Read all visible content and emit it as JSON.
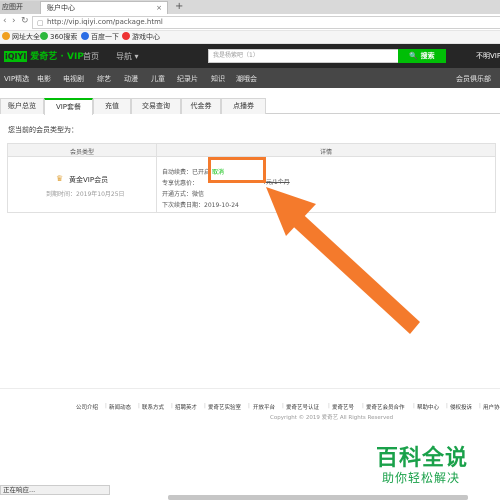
{
  "browser": {
    "tabs": [
      "应图开",
      "账户中心"
    ],
    "new_tab_symbol": "+",
    "close_symbol": "×",
    "url": "http://vip.iqiyi.com/package.html",
    "bookmarks": [
      "网址大全",
      "360搜索",
      "百度一下",
      "游戏中心"
    ]
  },
  "header": {
    "logo_box": "iQIYI",
    "logo_text": "爱奇艺 · VIP",
    "nav": [
      "首页",
      "导航 ▾"
    ],
    "search_placeholder": "我是杨紫吧（1）",
    "search_button": "🔍 搜索",
    "login": "不明VIP"
  },
  "categories": [
    "VIP精选",
    "电影",
    "电视剧",
    "综艺",
    "动漫",
    "儿童",
    "纪录片",
    "知识",
    "潮哦会",
    "会员俱乐部"
  ],
  "page_tabs": [
    "账户总览",
    "VIP套餐",
    "充值",
    "交易查询",
    "代金券",
    "点播券"
  ],
  "active_tab": "VIP套餐",
  "member_type_label": "您当前的会员类型为：",
  "table": {
    "headers": [
      "会员类型",
      "详情"
    ],
    "vip_name": "黄金VIP会员",
    "expire": "到期时间：2019年10月25日",
    "details": {
      "auto_renew_prefix": "自动续费：已",
      "auto_renew_status": "开启",
      "cancel": "取消",
      "price_label": "专享优惠价：",
      "price_value": "4元/1个月",
      "method_label": "开通方式：微信",
      "next_date": "下次续费日期：2019-10-24"
    }
  },
  "footer": {
    "links": [
      "公司介绍",
      "新闻动态",
      "联系方式",
      "招聘英才",
      "爱奇艺实验室",
      "开放平台",
      "爱奇艺号认证",
      "爱奇艺号",
      "爱奇艺会员合作",
      "帮助中心",
      "侵权投诉",
      "用户协"
    ],
    "copyright": "Copyright © 2019 爱奇艺 All Rights Reserved"
  },
  "status_bar": "正在响应...",
  "watermark": {
    "title": "百科全说",
    "subtitle": "助你轻松解决"
  },
  "colors": {
    "accent": "#00be06",
    "highlight": "#f47a2c",
    "header_bg": "#262626",
    "category_bg": "#474747",
    "watermark": "#1aa14a"
  }
}
